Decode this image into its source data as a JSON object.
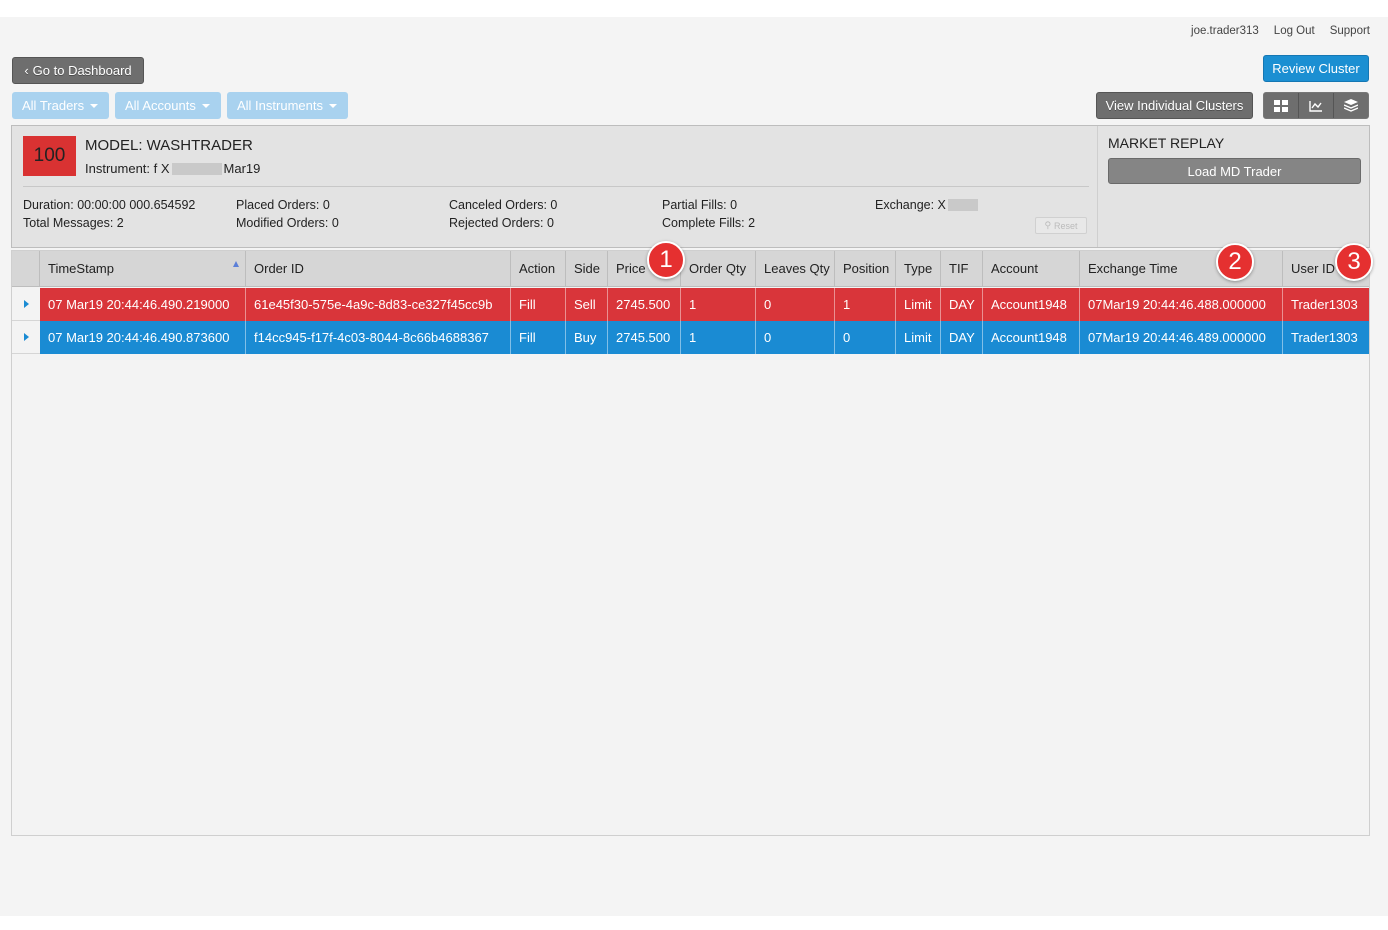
{
  "topbar": {
    "user": "joe.trader313",
    "logout": "Log Out",
    "support": "Support"
  },
  "nav": {
    "back_label": "Go to Dashboard",
    "review_label": "Review Cluster",
    "view_clusters_label": "View Individual Clusters"
  },
  "filters": {
    "traders": "All Traders",
    "accounts": "All Accounts",
    "instruments": "All Instruments"
  },
  "view_icons": [
    "grid-view-icon",
    "line-chart-icon",
    "layers-icon"
  ],
  "model": {
    "score": "100",
    "title": "MODEL: WASHTRADER",
    "instrument_prefix": "Instrument: f X",
    "instrument_suffix": "Mar19",
    "score_color": "#d93232"
  },
  "stats": {
    "duration": "Duration: 00:00:00 000.654592",
    "total_messages": "Total Messages: 2",
    "placed_orders": "Placed Orders: 0",
    "modified_orders": "Modified Orders: 0",
    "canceled_orders": "Canceled Orders: 0",
    "rejected_orders": "Rejected Orders: 0",
    "partial_fills": "Partial Fills: 0",
    "complete_fills": "Complete Fills: 2",
    "exchange": "Exchange: X",
    "reset_label": "Reset"
  },
  "market_replay": {
    "title": "MARKET REPLAY",
    "load_label": "Load MD Trader"
  },
  "table": {
    "columns": [
      "TimeStamp",
      "Order ID",
      "Action",
      "Side",
      "Price",
      "Order Qty",
      "Leaves Qty",
      "Position",
      "Type",
      "TIF",
      "Account",
      "Exchange Time",
      "User ID"
    ],
    "rows": [
      [
        "07 Mar19 20:44:46.490.219000",
        "61e45f30-575e-4a9c-8d83-ce327f45cc9b",
        "Fill",
        "Sell",
        "2745.500",
        "1",
        "0",
        "1",
        "Limit",
        "DAY",
        "Account1948",
        "07Mar19 20:44:46.488.000000",
        "Trader1303"
      ],
      [
        "07 Mar19 20:44:46.490.873600",
        "f14cc945-f17f-4c03-8044-8c66b4688367",
        "Fill",
        "Buy",
        "2745.500",
        "1",
        "0",
        "0",
        "Limit",
        "DAY",
        "Account1948",
        "07Mar19 20:44:46.489.000000",
        "Trader1303"
      ]
    ],
    "row_colors": {
      "sell": "#d9353a",
      "buy": "#1a8bd3"
    }
  },
  "callouts": [
    "1",
    "2",
    "3"
  ]
}
